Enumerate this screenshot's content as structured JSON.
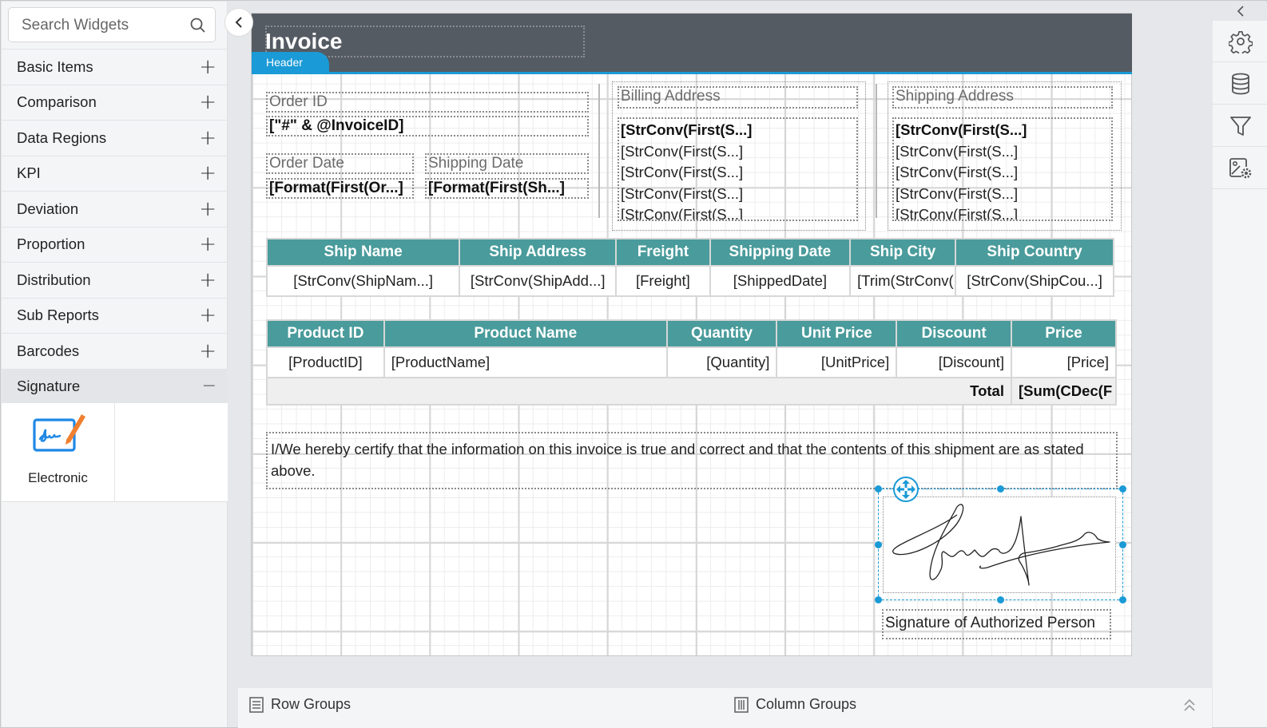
{
  "sidebar": {
    "search_placeholder": "Search Widgets",
    "categories": [
      {
        "label": "Basic Items",
        "state": "collapsed"
      },
      {
        "label": "Comparison",
        "state": "collapsed"
      },
      {
        "label": "Data Regions",
        "state": "collapsed"
      },
      {
        "label": "KPI",
        "state": "collapsed"
      },
      {
        "label": "Deviation",
        "state": "collapsed"
      },
      {
        "label": "Proportion",
        "state": "collapsed"
      },
      {
        "label": "Distribution",
        "state": "collapsed"
      },
      {
        "label": "Sub Reports",
        "state": "collapsed"
      },
      {
        "label": "Barcodes",
        "state": "collapsed"
      },
      {
        "label": "Signature",
        "state": "expanded"
      }
    ],
    "expand_symbol": "+",
    "collapse_symbol": "−",
    "signature_widgets": [
      {
        "label": "Electronic",
        "icon": "electronic-signature-icon"
      }
    ]
  },
  "report": {
    "title": "Invoice",
    "header_tag": "Header",
    "order_id_label": "Order ID",
    "order_id_value": "[\"#\" & @InvoiceID]",
    "order_date_label": "Order Date",
    "order_date_value": "[Format(First(Or...]",
    "shipping_date_label": "Shipping Date",
    "shipping_date_value": "[Format(First(Sh...]",
    "billing": {
      "label": "Billing Address",
      "lines": [
        "[StrConv(First(S...]",
        "[StrConv(First(S...]",
        "[StrConv(First(S...]",
        "[StrConv(First(S...]",
        "[StrConv(First(S...]"
      ]
    },
    "shipping": {
      "label": "Shipping Address",
      "lines": [
        "[StrConv(First(S...]",
        "[StrConv(First(S...]",
        "[StrConv(First(S...]",
        "[StrConv(First(S...]",
        "[StrConv(First(S...]"
      ]
    },
    "ship_table": {
      "headers": [
        "Ship Name",
        "Ship Address",
        "Freight",
        "Shipping Date",
        "Ship City",
        "Ship Country"
      ],
      "row": [
        "[StrConv(ShipNam...]",
        "[StrConv(ShipAdd...]",
        "[Freight]",
        "[ShippedDate]",
        "[Trim(StrConv(",
        "[StrConv(ShipCou...]"
      ]
    },
    "product_table": {
      "headers": [
        "Product ID",
        "Product Name",
        "Quantity",
        "Unit Price",
        "Discount",
        "Price"
      ],
      "row": [
        "[ProductID]",
        "[ProductName]",
        "[Quantity]",
        "[UnitPrice]",
        "[Discount]",
        "[Price]"
      ],
      "total_label": "Total",
      "total_value": "[Sum(CDec(F"
    },
    "certification": "I/We hereby certify that the information on this invoice is true and correct and that the contents of this shipment are as stated above.",
    "signature_caption": "Signature of Authorized Person"
  },
  "right_panel": {
    "items": [
      {
        "name": "properties",
        "icon": "gear-icon"
      },
      {
        "name": "data",
        "icon": "database-icon"
      },
      {
        "name": "parameters",
        "icon": "filter-icon"
      },
      {
        "name": "image-manager",
        "icon": "image-settings-icon"
      }
    ]
  },
  "bottom_bar": {
    "row_groups": "Row Groups",
    "column_groups": "Column Groups"
  },
  "colors": {
    "accent": "#1a9ad6",
    "table_header": "#4a9b9b",
    "report_header": "#555b63",
    "signature_icon_blue": "#1e88e5",
    "signature_icon_pen": "#f08030"
  }
}
